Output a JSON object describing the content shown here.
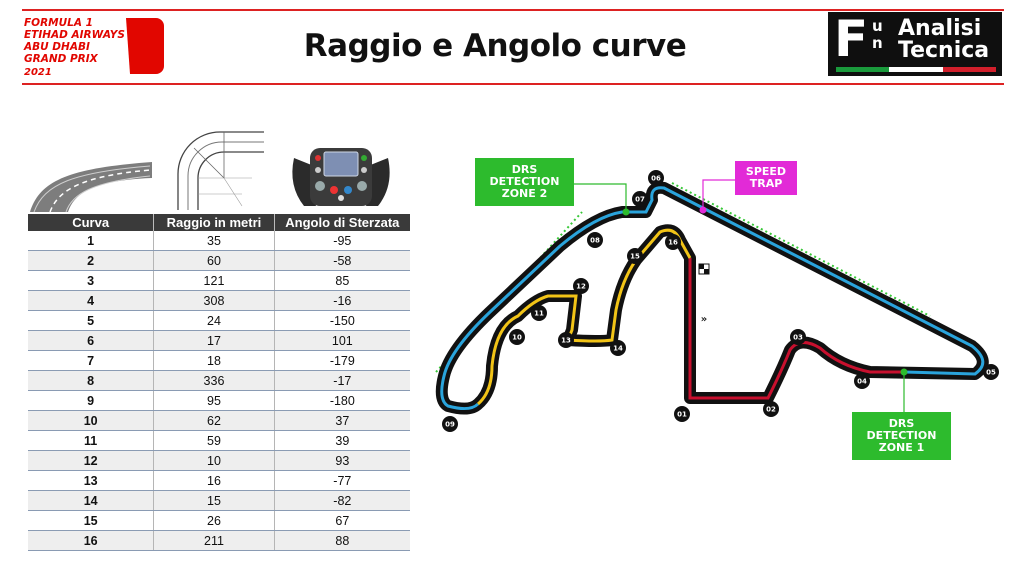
{
  "header": {
    "title": "Raggio e Angolo curve",
    "event_logo": {
      "lines": [
        "FORMULA 1",
        "ETIHAD AIRWAYS",
        "ABU DHABI",
        "GRAND PRIX"
      ],
      "year": "2021",
      "color": "#e10600"
    },
    "brand_logo": {
      "big_letter": "F",
      "side_letters": "u\nn",
      "line1": "Analisi",
      "line2": "Tecnica",
      "flag_colors": [
        "#1a9a3c",
        "#ffffff",
        "#d21f2b"
      ]
    },
    "accent_color": "#dd2222"
  },
  "table": {
    "columns": [
      "Curva",
      "Raggio in metri",
      "Angolo di Sterzata"
    ],
    "rows": [
      [
        "1",
        "35",
        "-95"
      ],
      [
        "2",
        "60",
        "-58"
      ],
      [
        "3",
        "121",
        "85"
      ],
      [
        "4",
        "308",
        "-16"
      ],
      [
        "5",
        "24",
        "-150"
      ],
      [
        "6",
        "17",
        "101"
      ],
      [
        "7",
        "18",
        "-179"
      ],
      [
        "8",
        "336",
        "-17"
      ],
      [
        "9",
        "95",
        "-180"
      ],
      [
        "10",
        "62",
        "37"
      ],
      [
        "11",
        "59",
        "39"
      ],
      [
        "12",
        "10",
        "93"
      ],
      [
        "13",
        "16",
        "-77"
      ],
      [
        "14",
        "15",
        "-82"
      ],
      [
        "15",
        "26",
        "67"
      ],
      [
        "16",
        "211",
        "88"
      ]
    ]
  },
  "map": {
    "drs_detection_zone_2": "DRS\nDETECTION\nZONE 2",
    "drs_detection_zone_1": "DRS\nDETECTION\nZONE 1",
    "speed_trap": "SPEED\nTRAP",
    "turn_labels": [
      "01",
      "02",
      "03",
      "04",
      "05",
      "06",
      "07",
      "08",
      "09",
      "10",
      "11",
      "12",
      "13",
      "14",
      "15",
      "16"
    ],
    "colors": {
      "sector1": "#c8102e",
      "sector2": "#2aa4dc",
      "sector3": "#f2c417",
      "drs_box": "#2dbb2d",
      "speed_trap_box": "#e22ad7"
    }
  }
}
